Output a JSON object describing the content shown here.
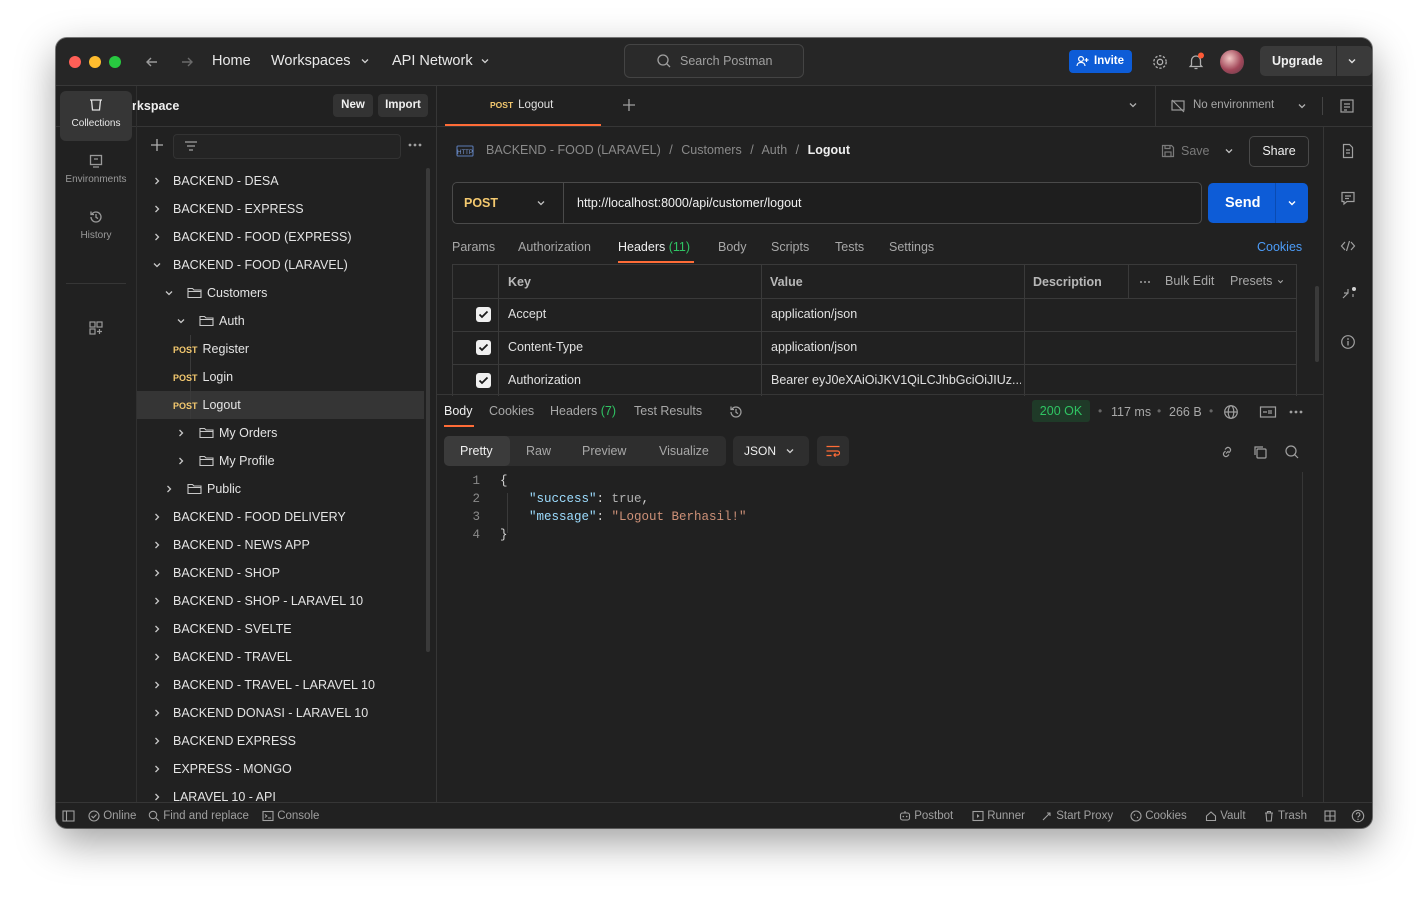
{
  "titlebar": {
    "nav": {
      "home": "Home",
      "workspaces": "Workspaces",
      "api_network": "API Network"
    },
    "search_placeholder": "Search Postman",
    "invite_label": "Invite",
    "upgrade_label": "Upgrade"
  },
  "workspace": {
    "name": "My Workspace",
    "new_label": "New",
    "import_label": "Import"
  },
  "rail": [
    {
      "label": "Collections",
      "icon": "collections-icon"
    },
    {
      "label": "Environments",
      "icon": "environments-icon"
    },
    {
      "label": "History",
      "icon": "history-icon"
    }
  ],
  "tree": [
    {
      "label": "BACKEND - DESA",
      "indent": 0,
      "arrow": "right",
      "kind": "collection"
    },
    {
      "label": "BACKEND - EXPRESS",
      "indent": 0,
      "arrow": "right",
      "kind": "collection"
    },
    {
      "label": "BACKEND - FOOD (EXPRESS)",
      "indent": 0,
      "arrow": "right",
      "kind": "collection"
    },
    {
      "label": "BACKEND - FOOD (LARAVEL)",
      "indent": 0,
      "arrow": "down",
      "kind": "collection"
    },
    {
      "label": "Customers",
      "indent": 1,
      "arrow": "down",
      "kind": "folder"
    },
    {
      "label": "Auth",
      "indent": 2,
      "arrow": "down",
      "kind": "folder"
    },
    {
      "label": "Register",
      "indent": 3,
      "arrow": "",
      "kind": "request",
      "method": "POST"
    },
    {
      "label": "Login",
      "indent": 3,
      "arrow": "",
      "kind": "request",
      "method": "POST"
    },
    {
      "label": "Logout",
      "indent": 3,
      "arrow": "",
      "kind": "request",
      "method": "POST",
      "selected": true
    },
    {
      "label": "My Orders",
      "indent": 2,
      "arrow": "right",
      "kind": "folder"
    },
    {
      "label": "My Profile",
      "indent": 2,
      "arrow": "right",
      "kind": "folder"
    },
    {
      "label": "Public",
      "indent": 1,
      "arrow": "right",
      "kind": "folder"
    },
    {
      "label": "BACKEND - FOOD DELIVERY",
      "indent": 0,
      "arrow": "right",
      "kind": "collection"
    },
    {
      "label": "BACKEND - NEWS APP",
      "indent": 0,
      "arrow": "right",
      "kind": "collection"
    },
    {
      "label": "BACKEND - SHOP",
      "indent": 0,
      "arrow": "right",
      "kind": "collection"
    },
    {
      "label": "BACKEND - SHOP - LARAVEL 10",
      "indent": 0,
      "arrow": "right",
      "kind": "collection"
    },
    {
      "label": "BACKEND - SVELTE",
      "indent": 0,
      "arrow": "right",
      "kind": "collection"
    },
    {
      "label": "BACKEND - TRAVEL",
      "indent": 0,
      "arrow": "right",
      "kind": "collection"
    },
    {
      "label": "BACKEND - TRAVEL - LARAVEL 10",
      "indent": 0,
      "arrow": "right",
      "kind": "collection"
    },
    {
      "label": "BACKEND DONASI - LARAVEL 10",
      "indent": 0,
      "arrow": "right",
      "kind": "collection"
    },
    {
      "label": "BACKEND EXPRESS",
      "indent": 0,
      "arrow": "right",
      "kind": "collection"
    },
    {
      "label": "EXPRESS - MONGO",
      "indent": 0,
      "arrow": "right",
      "kind": "collection"
    },
    {
      "label": "LARAVEL 10 - API",
      "indent": 0,
      "arrow": "right",
      "kind": "collection"
    }
  ],
  "tab": {
    "method": "POST",
    "name": "Logout"
  },
  "environment": "No environment",
  "breadcrumb": {
    "parts": [
      "BACKEND - FOOD (LARAVEL)",
      "Customers",
      "Auth"
    ],
    "current": "Logout",
    "sep": "/"
  },
  "actions": {
    "save": "Save",
    "share": "Share"
  },
  "request": {
    "method": "POST",
    "url": "http://localhost:8000/api/customer/logout",
    "send": "Send"
  },
  "req_tabs": [
    "Params",
    "Authorization",
    "Headers",
    "Body",
    "Scripts",
    "Tests",
    "Settings"
  ],
  "headers_count": "(11)",
  "cookies_link": "Cookies",
  "headers_table": {
    "columns": {
      "key": "Key",
      "value": "Value",
      "description": "Description",
      "bulk_edit": "Bulk Edit",
      "presets": "Presets"
    },
    "rows": [
      {
        "key": "Accept",
        "value": "application/json",
        "checked": true
      },
      {
        "key": "Content-Type",
        "value": "application/json",
        "checked": true
      },
      {
        "key": "Authorization",
        "value": "Bearer eyJ0eXAiOiJKV1QiLCJhbGciOiJIUz...",
        "checked": true
      }
    ]
  },
  "response": {
    "tabs": {
      "body": "Body",
      "cookies": "Cookies",
      "headers": "Headers",
      "headers_count": "(7)",
      "test_results": "Test Results"
    },
    "status": "200 OK",
    "time": "117 ms",
    "size": "266 B",
    "views": [
      "Pretty",
      "Raw",
      "Preview",
      "Visualize"
    ],
    "format": "JSON",
    "code_lines": [
      {
        "n": "1",
        "indent": 0,
        "parts": [
          {
            "t": "{",
            "c": "#d4d4d4"
          }
        ]
      },
      {
        "n": "2",
        "indent": 1,
        "parts": [
          {
            "t": "\"success\"",
            "c": "#9cdcfe"
          },
          {
            "t": ": ",
            "c": "#d4d4d4"
          },
          {
            "t": "true",
            "c": "#b0b0b0"
          },
          {
            "t": ",",
            "c": "#d4d4d4"
          }
        ]
      },
      {
        "n": "3",
        "indent": 1,
        "parts": [
          {
            "t": "\"message\"",
            "c": "#9cdcfe"
          },
          {
            "t": ": ",
            "c": "#d4d4d4"
          },
          {
            "t": "\"Logout Berhasil!\"",
            "c": "#ce9178"
          }
        ]
      },
      {
        "n": "4",
        "indent": 0,
        "parts": [
          {
            "t": "}",
            "c": "#d4d4d4"
          }
        ]
      }
    ]
  },
  "statusbar": {
    "online": "Online",
    "find_replace": "Find and replace",
    "console": "Console",
    "postbot": "Postbot",
    "runner": "Runner",
    "start_proxy": "Start Proxy",
    "cookies": "Cookies",
    "vault": "Vault",
    "trash": "Trash"
  },
  "colors": {
    "accent": "#0d5cd7",
    "method_post": "#f4c96f",
    "status_ok": "#2fc463",
    "tab_underline": "#ff6c37"
  }
}
